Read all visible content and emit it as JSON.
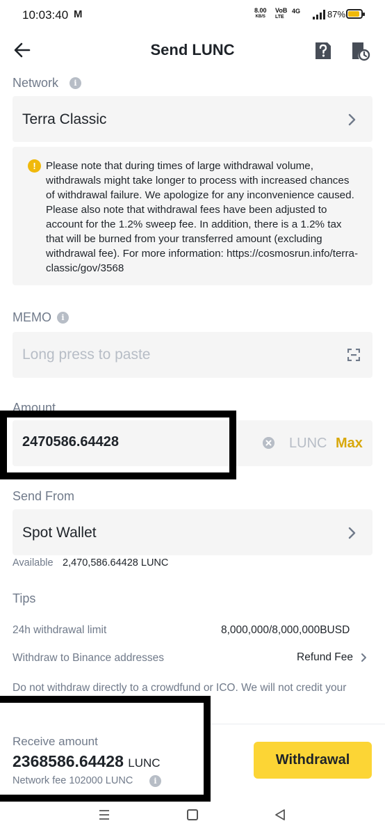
{
  "status_bar": {
    "time": "10:03:40",
    "notification": "M",
    "speed_value": "8.00",
    "speed_unit": "KB/S",
    "volte_top": "VoB",
    "volte_bottom": "LTE",
    "network_type": "4G",
    "battery": "87%"
  },
  "header": {
    "title": "Send LUNC",
    "back_icon": "arrow-left-icon",
    "help_icon": "help-doc-icon",
    "history_icon": "history-icon"
  },
  "network": {
    "label": "Network",
    "value": "Terra Classic"
  },
  "notice": {
    "icon": "!",
    "text": "Please note that during times of large withdrawal volume, withdrawals might take longer to process with increased chances of withdrawal failure. We apologize for any inconvenience caused. Please also note that withdrawal fees have been adjusted to account for the 1.2% sweep fee. In addition, there is a 1.2% tax that will be burned from your transferred amount (excluding withdrawal fee). For more information: https://cosmosrun.info/terra-classic/gov/3568"
  },
  "memo": {
    "label": "MEMO",
    "placeholder": "Long press to paste",
    "value": ""
  },
  "amount": {
    "label": "Amount",
    "value": "2470586.64428",
    "unit": "LUNC",
    "max_label": "Max"
  },
  "send_from": {
    "label": "Send From",
    "value": "Spot Wallet",
    "available_label": "Available",
    "available_value": "2,470,586.64428 LUNC"
  },
  "tips": {
    "label": "Tips",
    "limit_label": "24h withdrawal limit",
    "limit_value": "8,000,000/8,000,000BUSD",
    "binance_label": "Withdraw to Binance addresses",
    "refund_label": "Refund Fee",
    "warning": "Do not withdraw directly to a crowdfund or ICO. We will not credit your account with tokens from that sale."
  },
  "receive": {
    "label": "Receive amount",
    "value": "2368586.64428",
    "unit": "LUNC",
    "fee_label": "Network fee 102000 LUNC"
  },
  "withdraw_button": "Withdrawal",
  "colors": {
    "accent": "#fcd535",
    "max": "#d8a80b",
    "muted": "#707a8a",
    "field_bg": "#f5f5f5"
  }
}
